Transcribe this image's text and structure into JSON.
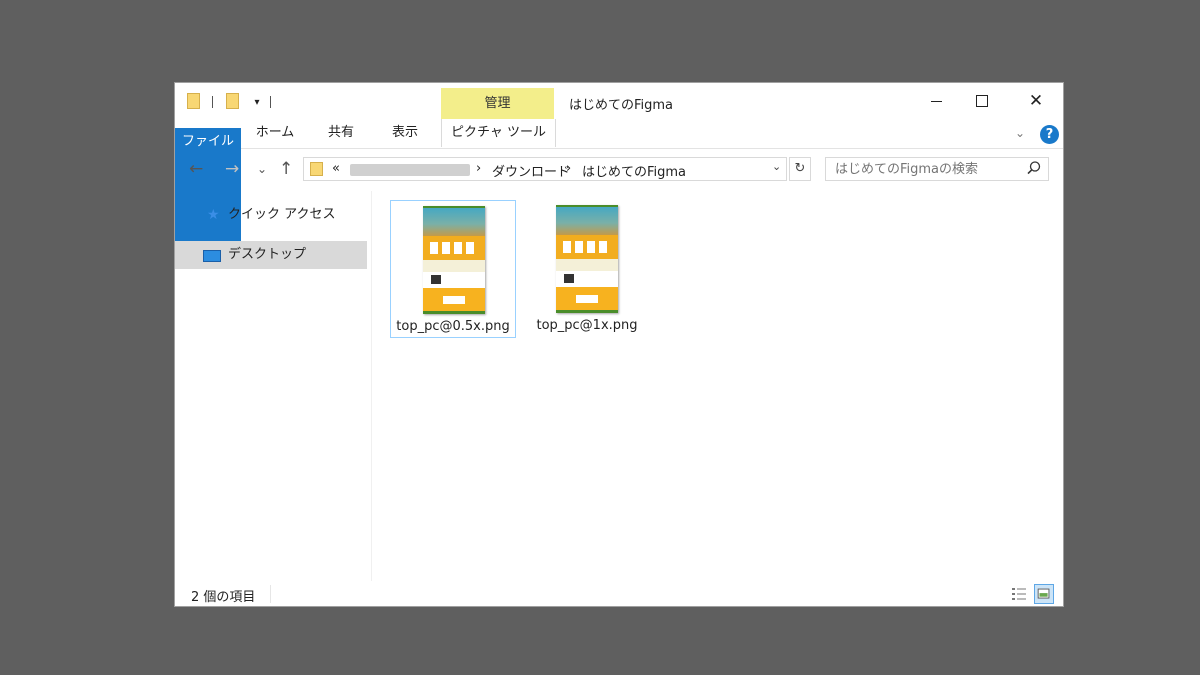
{
  "window": {
    "title": "はじめてのFigma",
    "context_tab": "管理",
    "controls": {
      "minimize": "minimize",
      "maximize": "maximize",
      "close": "✕"
    }
  },
  "ribbon": {
    "tabs": [
      "ファイル",
      "ホーム",
      "共有",
      "表示",
      "ピクチャ ツール"
    ],
    "help": "?"
  },
  "nav": {
    "back": "←",
    "forward": "→",
    "recent": "⌄",
    "up": "↑",
    "address": {
      "prefix": "«",
      "sep1": "›",
      "crumb1": "ダウンロード",
      "sep2": "›",
      "crumb2": "はじめてのFigma",
      "dropdown": "⌄",
      "refresh": "↻"
    },
    "search_placeholder": "はじめてのFigmaの検索"
  },
  "sidebar": {
    "items": [
      {
        "label": "クイック アクセス",
        "icon": "star-icon",
        "selected": false
      },
      {
        "label": "デスクトップ",
        "icon": "desktop-icon",
        "selected": true
      }
    ]
  },
  "files": [
    {
      "name": "top_pc@0.5x.png",
      "selected": true
    },
    {
      "name": "top_pc@1x.png",
      "selected": false
    }
  ],
  "status": {
    "count": "2 個の項目"
  },
  "colors": {
    "accent": "#1979ca",
    "manage_tab": "#f3ee8b",
    "selection": "#99d1ff"
  }
}
